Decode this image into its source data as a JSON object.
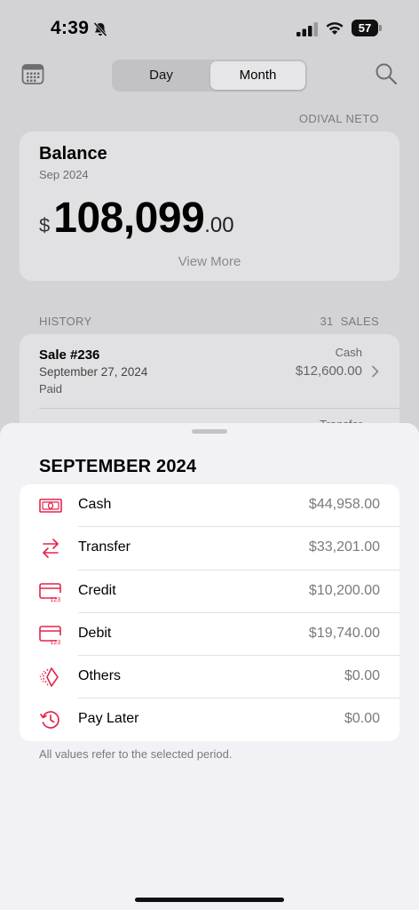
{
  "status_bar": {
    "time": "4:39",
    "battery": "57"
  },
  "nav": {
    "calendar_icon": "calendar-icon",
    "segments": [
      {
        "label": "Day",
        "selected": false
      },
      {
        "label": "Month",
        "selected": true
      }
    ],
    "search_icon": "magnifier-icon"
  },
  "user": {
    "name": "ODIVAL NETO"
  },
  "balance": {
    "title": "Balance",
    "period": "Sep 2024",
    "currency": "$",
    "amount_int": "108,099",
    "amount_dec": ".00",
    "view_more": "View More"
  },
  "history": {
    "label": "HISTORY",
    "count": "31",
    "count_label": "SALES",
    "items": [
      {
        "title": "Sale #236",
        "date": "September 27, 2024",
        "status": "Paid",
        "method": "Cash",
        "amount": "$12,600.00"
      },
      {
        "method": "Transfer"
      }
    ]
  },
  "sheet": {
    "title": "SEPTEMBER 2024",
    "methods": [
      {
        "label": "Cash",
        "value": "$44,958.00",
        "icon": "cash-icon"
      },
      {
        "label": "Transfer",
        "value": "$33,201.00",
        "icon": "transfer-arrows-icon"
      },
      {
        "label": "Credit",
        "value": "$10,200.00",
        "icon": "credit-card-icon"
      },
      {
        "label": "Debit",
        "value": "$19,740.00",
        "icon": "debit-card-icon"
      },
      {
        "label": "Others",
        "value": "$0.00",
        "icon": "others-icon"
      },
      {
        "label": "Pay Later",
        "value": "$0.00",
        "icon": "clock-history-icon"
      }
    ],
    "footnote": "All values refer to the selected period."
  },
  "colors": {
    "accent": "#e5234b",
    "background": "#d3d3d6",
    "sheet": "#f2f1f6"
  }
}
